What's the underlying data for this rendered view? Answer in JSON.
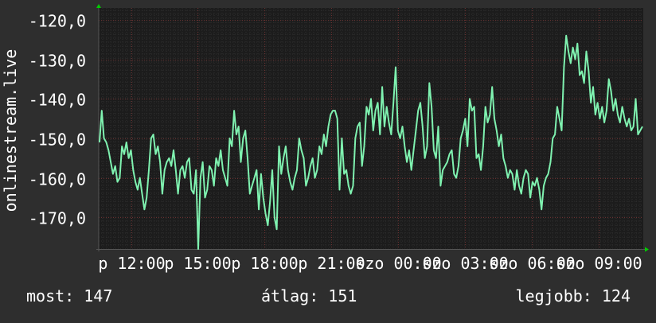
{
  "chart_data": {
    "type": "line",
    "ylabel": "onlinestream.live",
    "ylim": [
      -178,
      -117
    ],
    "yticks": [
      -120,
      -130,
      -140,
      -150,
      -160,
      -170
    ],
    "ytick_labels": [
      "-120,0",
      "-130,0",
      "-140,0",
      "-150,0",
      "-160,0",
      "-170,0"
    ],
    "xtick_labels": [
      "p 12:00",
      "p 15:00",
      "p 18:00",
      "p 21:00",
      "szo 00:00",
      "szo 03:00",
      "szo 06:00",
      "szo 09:00"
    ],
    "xtick_hours": [
      12,
      15,
      18,
      21,
      24,
      27,
      30,
      33
    ],
    "x_start_hour": 10.55,
    "x_end_hour": 35.0,
    "grid": true,
    "colors": {
      "line": "#7ff2b0",
      "background": "#2e2e2e",
      "plot_bg": "#1c1c1c",
      "grid": "#4a4a4a",
      "axis_arrow": "#00cc00"
    },
    "values": [
      -151,
      -143,
      -150,
      -151,
      -153,
      -156,
      -159,
      -157,
      -161,
      -160,
      -152,
      -154,
      -151,
      -155,
      -153,
      -158,
      -161,
      -163,
      -160,
      -164,
      -168,
      -165,
      -158,
      -150,
      -149,
      -154,
      -152,
      -156,
      -164,
      -158,
      -156,
      -155,
      -157,
      -153,
      -158,
      -164,
      -158,
      -157,
      -160,
      -156,
      -155,
      -163,
      -164,
      -158,
      -178,
      -160,
      -156,
      -165,
      -163,
      -157,
      -158,
      -162,
      -155,
      -157,
      -153,
      -158,
      -160,
      -162,
      -150,
      -152,
      -143,
      -149,
      -147,
      -156,
      -150,
      -148,
      -155,
      -164,
      -162,
      -160,
      -158,
      -168,
      -159,
      -165,
      -169,
      -172,
      -166,
      -158,
      -170,
      -173,
      -152,
      -159,
      -155,
      -152,
      -158,
      -161,
      -163,
      -160,
      -158,
      -150,
      -153,
      -155,
      -162,
      -160,
      -157,
      -155,
      -160,
      -158,
      -152,
      -154,
      -149,
      -152,
      -147,
      -144,
      -143,
      -143,
      -145,
      -163,
      -150,
      -159,
      -158,
      -162,
      -164,
      -162,
      -150,
      -147,
      -146,
      -157,
      -152,
      -142,
      -144,
      -140,
      -148,
      -143,
      -141,
      -149,
      -137,
      -147,
      -142,
      -146,
      -149,
      -141,
      -132,
      -148,
      -150,
      -147,
      -152,
      -156,
      -153,
      -158,
      -153,
      -148,
      -143,
      -141,
      -147,
      -155,
      -152,
      -136,
      -142,
      -153,
      -155,
      -147,
      -162,
      -158,
      -157,
      -156,
      -154,
      -153,
      -159,
      -160,
      -157,
      -150,
      -148,
      -145,
      -152,
      -140,
      -143,
      -142,
      -155,
      -154,
      -158,
      -152,
      -142,
      -146,
      -144,
      -137,
      -145,
      -148,
      -152,
      -149,
      -155,
      -157,
      -160,
      -158,
      -159,
      -163,
      -158,
      -162,
      -164,
      -160,
      -158,
      -159,
      -165,
      -161,
      -162,
      -160,
      -163,
      -168,
      -162,
      -160,
      -159,
      -156,
      -150,
      -149,
      -142,
      -145,
      -148,
      -132,
      -124,
      -128,
      -131,
      -127,
      -130,
      -126,
      -134,
      -133,
      -136,
      -128,
      -133,
      -141,
      -137,
      -144,
      -141,
      -145,
      -142,
      -146,
      -143,
      -135,
      -138,
      -143,
      -140,
      -144,
      -146,
      -142,
      -145,
      -147,
      -145,
      -148,
      -147,
      -140,
      -149,
      -148,
      -147
    ]
  },
  "stats": {
    "current": "most: 147",
    "average": "átlag: 151",
    "best": "legjobb: 124"
  }
}
